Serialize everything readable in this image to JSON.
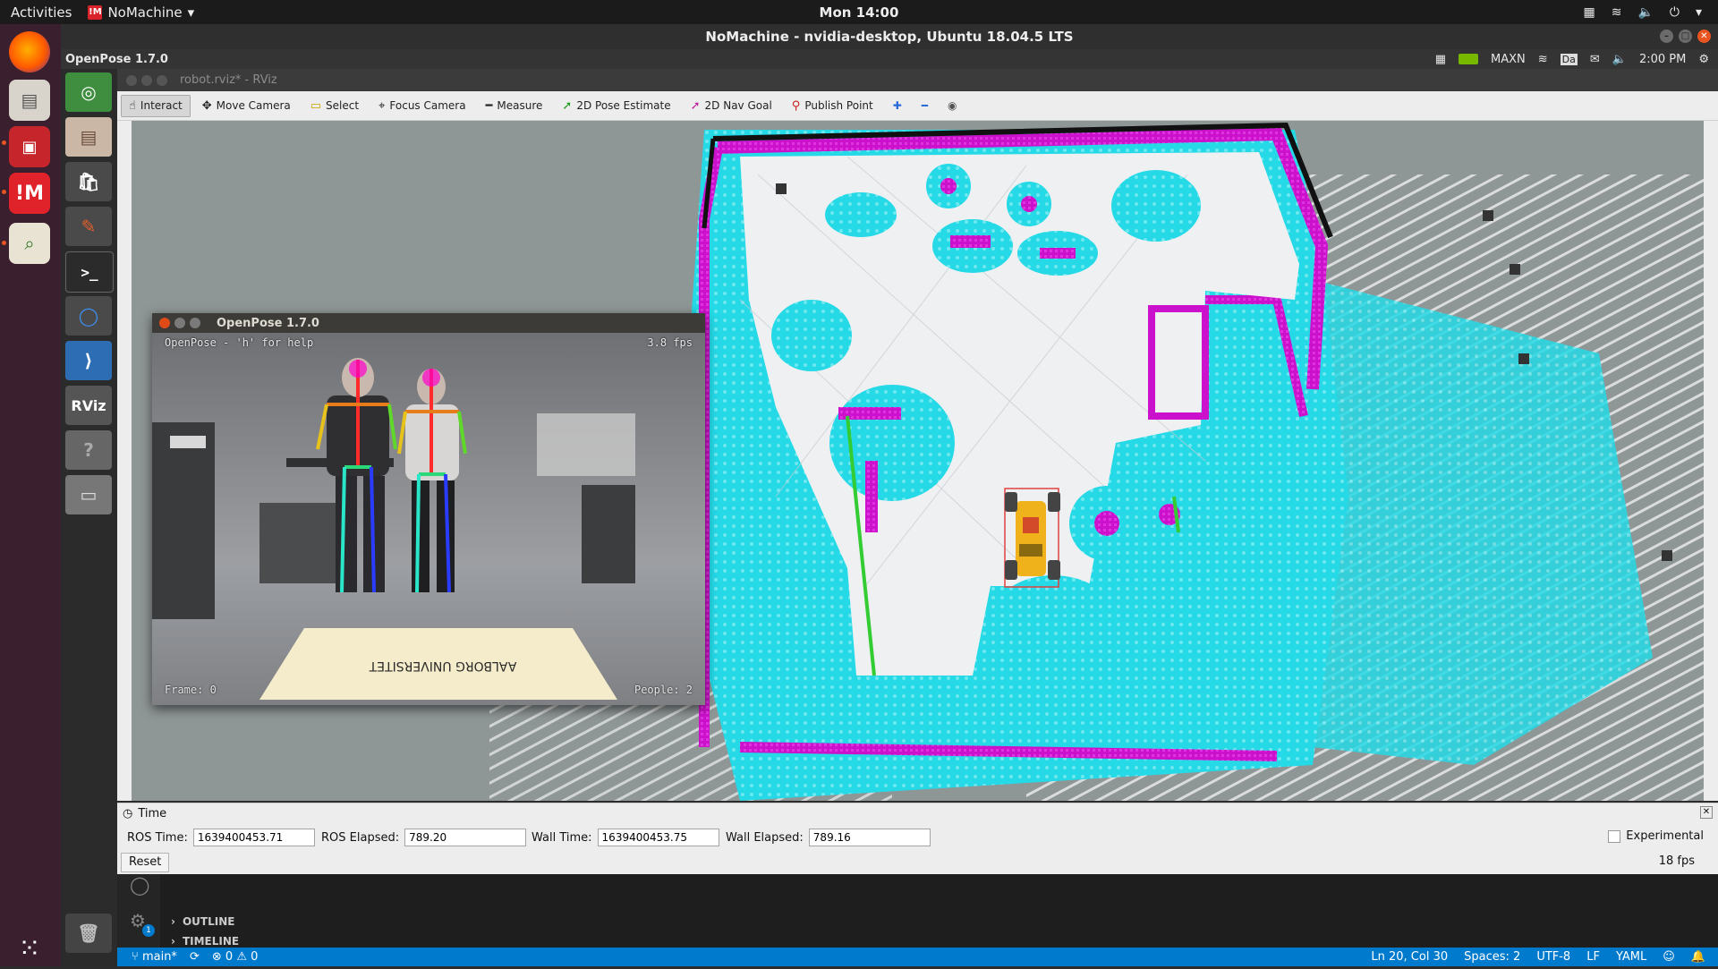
{
  "topbar": {
    "activities": "Activities",
    "app_name": "NoMachine",
    "clock": "Mon 14:00"
  },
  "nomachine": {
    "window_title": "NoMachine - nvidia-desktop, Ubuntu 18.04.5 LTS"
  },
  "remote_panel": {
    "app_label": "OpenPose 1.7.0",
    "power_mode": "MAXN",
    "clock": "2:00 PM",
    "keyboard_layout": "Da"
  },
  "rviz": {
    "window_title": "robot.rviz* - RViz",
    "tools": [
      {
        "label": "Interact",
        "icon": "cursor-hand-icon",
        "active": true
      },
      {
        "label": "Move Camera",
        "icon": "move-icon"
      },
      {
        "label": "Select",
        "icon": "select-box-icon"
      },
      {
        "label": "Focus Camera",
        "icon": "crosshair-icon"
      },
      {
        "label": "Measure",
        "icon": "ruler-icon"
      },
      {
        "label": "2D Pose Estimate",
        "icon": "green-arrow-icon"
      },
      {
        "label": "2D Nav Goal",
        "icon": "magenta-arrow-icon"
      },
      {
        "label": "Publish Point",
        "icon": "pin-icon"
      }
    ]
  },
  "openpose": {
    "title": "OpenPose 1.7.0",
    "help": "OpenPose - 'h' for help",
    "fps": "3.8 fps",
    "frame": "Frame: 0",
    "people": "People: 2",
    "mat_text": "AALBORG UNIVERSITET"
  },
  "time_panel": {
    "title": "Time",
    "ros_time_label": "ROS Time:",
    "ros_time": "1639400453.71",
    "ros_elapsed_label": "ROS Elapsed:",
    "ros_elapsed": "789.20",
    "wall_time_label": "Wall Time:",
    "wall_time": "1639400453.75",
    "wall_elapsed_label": "Wall Elapsed:",
    "wall_elapsed": "789.16",
    "reset": "Reset",
    "experimental": "Experimental",
    "fps": "18 fps"
  },
  "vscode": {
    "outline": "OUTLINE",
    "timeline": "TIMELINE",
    "settings_badge": "1",
    "status": {
      "branch": "main*",
      "problems": "0",
      "warnings": "0",
      "position": "Ln 20, Col 30",
      "spaces": "Spaces: 2",
      "encoding": "UTF-8",
      "eol": "LF",
      "language": "YAML"
    }
  },
  "colors": {
    "costmap_cyan": "#25d9e6",
    "costmap_magenta": "#cc11cc",
    "map_free": "#eef0f2",
    "map_unknown": "#8f9696",
    "robot_yellow": "#f0b21a",
    "vscode_blue": "#007acc",
    "ubuntu_orange": "#e95420"
  }
}
